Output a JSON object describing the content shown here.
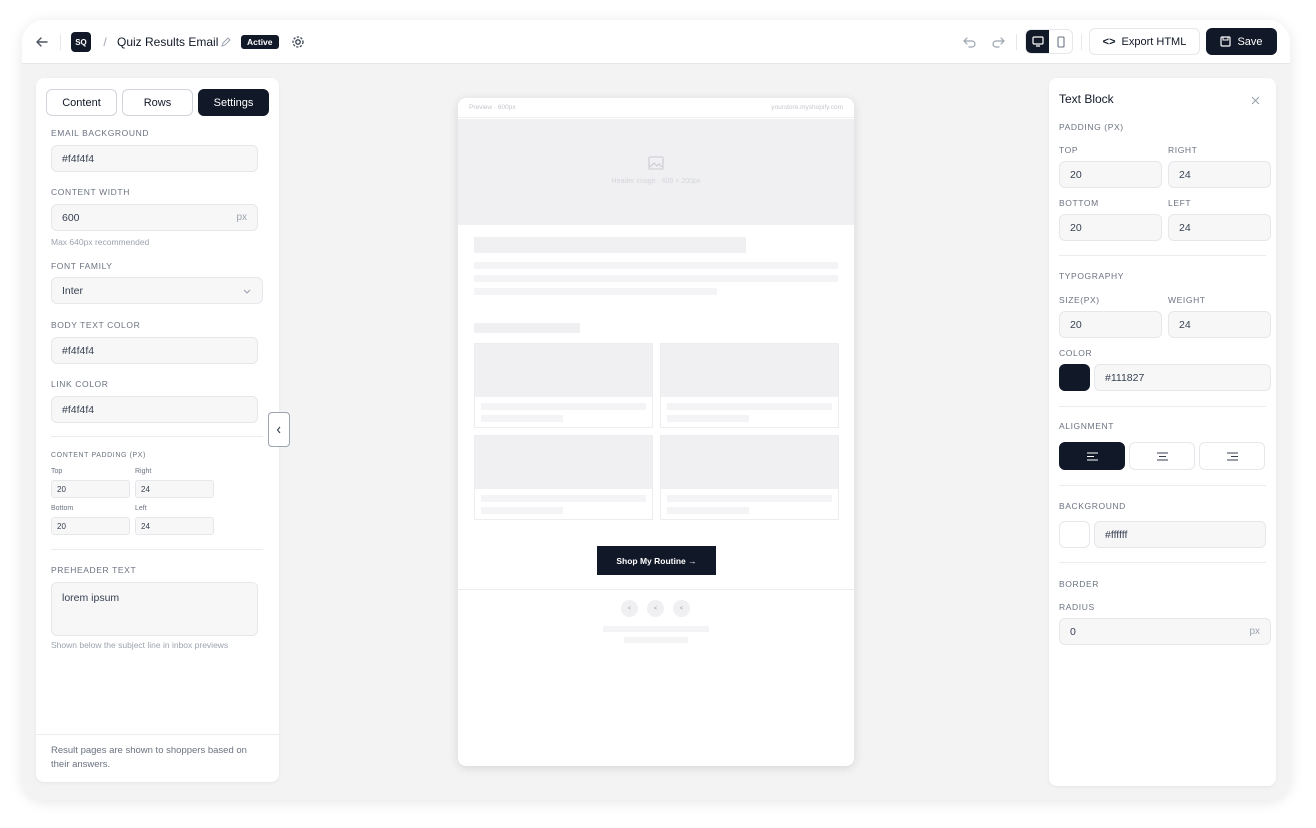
{
  "header": {
    "back_icon": "arrow-left-icon",
    "logo_text": "SQ",
    "breadcrumb_sep": "/",
    "title": "Quiz Results Email",
    "status_badge": "Active",
    "export_label": "Export HTML",
    "save_label": "Save"
  },
  "left_panel": {
    "tabs": [
      {
        "label": "Content"
      },
      {
        "label": "Rows"
      },
      {
        "label": "Settings"
      }
    ],
    "active_tab": "Settings",
    "email_background": {
      "label": "EMAIL BACKGROUND",
      "value": "#f4f4f4"
    },
    "content_width": {
      "label": "CONTENT WIDTH",
      "value": "600",
      "unit": "px",
      "hint": "Max 640px recommended"
    },
    "font_family": {
      "label": "FONT FAMILY",
      "value": "Inter"
    },
    "body_text_color": {
      "label": "BODY TEXT COLOR",
      "value": "#f4f4f4"
    },
    "link_color": {
      "label": "LINK COLOR",
      "value": "#f4f4f4"
    },
    "content_padding": {
      "label": "CONTENT PADDING (PX)",
      "top": {
        "label": "Top",
        "value": "20"
      },
      "right": {
        "label": "Right",
        "value": "24"
      },
      "bottom": {
        "label": "Bottom",
        "value": "20"
      },
      "left": {
        "label": "Left",
        "value": "24"
      }
    },
    "preheader": {
      "label": "PREHEADER TEXT",
      "value": "lorem ipsum",
      "hint": "Shown below the subject line in inbox previews"
    },
    "footer_note": "Result pages are shown to shoppers based on their answers."
  },
  "preview": {
    "size_label": "Preview · 600px",
    "domain": "yourstore.myshopify.com",
    "header_image_label": "Header image · 600 × 200px",
    "cta_label": "Shop My Routine →"
  },
  "right_panel": {
    "title": "Text Block",
    "padding": {
      "label": "PADDING (PX)",
      "top": {
        "label": "TOP",
        "value": "20"
      },
      "right": {
        "label": "RIGHT",
        "value": "24"
      },
      "bottom": {
        "label": "BOTTOM",
        "value": "20"
      },
      "left": {
        "label": "LEFT",
        "value": "24"
      }
    },
    "typography": {
      "label": "TYPOGRAPHY",
      "size": {
        "label": "SIZE(PX)",
        "value": "20"
      },
      "weight": {
        "label": "WEIGHT",
        "value": "24"
      },
      "color_label": "COLOR",
      "color_value": "#111827"
    },
    "alignment": {
      "label": "ALIGNMENT",
      "options": [
        "left",
        "center",
        "right"
      ],
      "selected": "left"
    },
    "background": {
      "label": "BACKGROUND",
      "value": "#ffffff"
    },
    "border": {
      "label": "BORDER",
      "radius_label": "RADIUS",
      "radius_value": "0",
      "unit": "px"
    }
  },
  "colors": {
    "accent": "#111827",
    "panel_bg": "#ffffff",
    "canvas_bg": "#f3f3f4"
  }
}
